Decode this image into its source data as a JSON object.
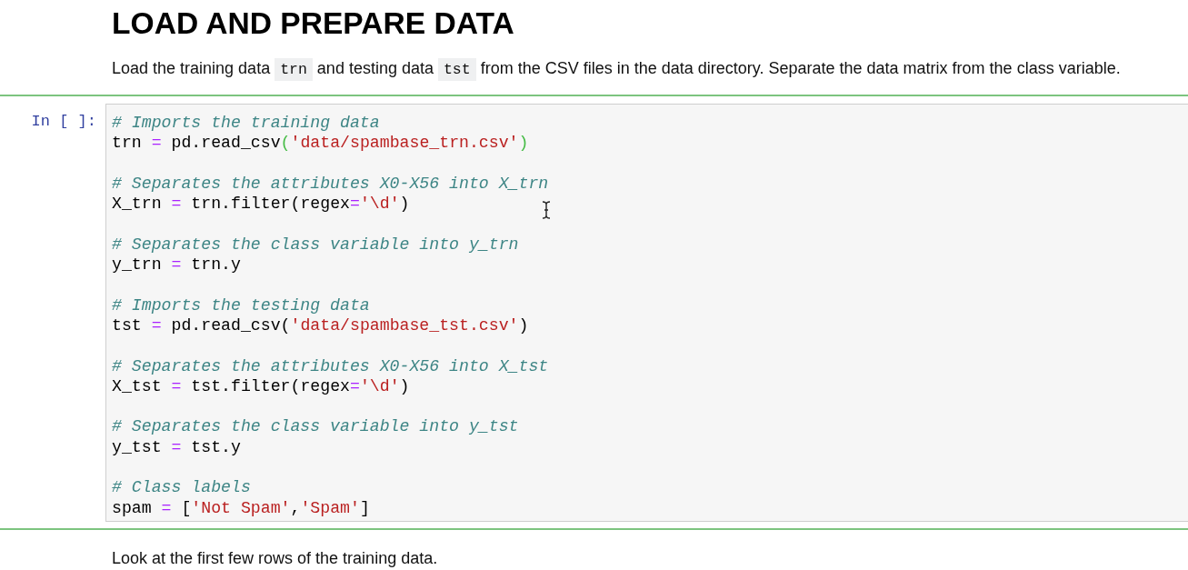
{
  "heading": {
    "text": "LOAD AND PREPARE DATA"
  },
  "intro": {
    "segments": [
      {
        "kind": "text",
        "text": "Load the training data "
      },
      {
        "kind": "code",
        "text": "trn"
      },
      {
        "kind": "text",
        "text": " and testing data "
      },
      {
        "kind": "code",
        "text": "tst"
      },
      {
        "kind": "text",
        "text": " from the CSV files in the data directory. Separate the data matrix from the class variable."
      }
    ]
  },
  "code_cell": {
    "selected": true,
    "prompt": "In [ ]:",
    "blocks": [
      {
        "lines": [
          [
            {
              "kind": "comment",
              "text": "# Imports the training data"
            }
          ],
          [
            {
              "kind": "plain",
              "text": "trn "
            },
            {
              "kind": "operator",
              "text": "="
            },
            {
              "kind": "plain",
              "text": " pd.read_csv"
            },
            {
              "kind": "matched-bracket",
              "text": "("
            },
            {
              "kind": "string",
              "text": "'data/spambase_trn.csv'"
            },
            {
              "kind": "matched-bracket",
              "text": ")"
            }
          ]
        ]
      },
      {
        "lines": [
          [
            {
              "kind": "comment",
              "text": "# Separates the attributes X0-X56 into X_trn"
            }
          ],
          [
            {
              "kind": "plain",
              "text": "X_trn "
            },
            {
              "kind": "operator",
              "text": "="
            },
            {
              "kind": "plain",
              "text": " trn.filter(regex"
            },
            {
              "kind": "operator",
              "text": "="
            },
            {
              "kind": "string",
              "text": "'\\d'"
            },
            {
              "kind": "plain",
              "text": ")"
            }
          ]
        ]
      },
      {
        "lines": [
          [
            {
              "kind": "comment",
              "text": "# Separates the class variable into y_trn"
            }
          ],
          [
            {
              "kind": "plain",
              "text": "y_trn "
            },
            {
              "kind": "operator",
              "text": "="
            },
            {
              "kind": "plain",
              "text": " trn.y"
            }
          ]
        ]
      },
      {
        "lines": [
          [
            {
              "kind": "comment",
              "text": "# Imports the testing data"
            }
          ],
          [
            {
              "kind": "plain",
              "text": "tst "
            },
            {
              "kind": "operator",
              "text": "="
            },
            {
              "kind": "plain",
              "text": " pd.read_csv("
            },
            {
              "kind": "string",
              "text": "'data/spambase_tst.csv'"
            },
            {
              "kind": "plain",
              "text": ")"
            }
          ]
        ]
      },
      {
        "lines": [
          [
            {
              "kind": "comment",
              "text": "# Separates the attributes X0-X56 into X_tst"
            }
          ],
          [
            {
              "kind": "plain",
              "text": "X_tst "
            },
            {
              "kind": "operator",
              "text": "="
            },
            {
              "kind": "plain",
              "text": " tst.filter(regex"
            },
            {
              "kind": "operator",
              "text": "="
            },
            {
              "kind": "string",
              "text": "'\\d'"
            },
            {
              "kind": "plain",
              "text": ")"
            }
          ]
        ]
      },
      {
        "lines": [
          [
            {
              "kind": "comment",
              "text": "# Separates the class variable into y_tst"
            }
          ],
          [
            {
              "kind": "plain",
              "text": "y_tst "
            },
            {
              "kind": "operator",
              "text": "="
            },
            {
              "kind": "plain",
              "text": " tst.y"
            }
          ]
        ]
      },
      {
        "lines": [
          [
            {
              "kind": "comment",
              "text": "# Class labels"
            }
          ],
          [
            {
              "kind": "plain",
              "text": "spam "
            },
            {
              "kind": "operator",
              "text": "="
            },
            {
              "kind": "plain",
              "text": " ["
            },
            {
              "kind": "string",
              "text": "'Not Spam'"
            },
            {
              "kind": "plain",
              "text": ","
            },
            {
              "kind": "string",
              "text": "'Spam'"
            },
            {
              "kind": "plain",
              "text": "]"
            }
          ]
        ]
      }
    ]
  },
  "outro": {
    "text": "Look at the first few rows of the training data."
  }
}
